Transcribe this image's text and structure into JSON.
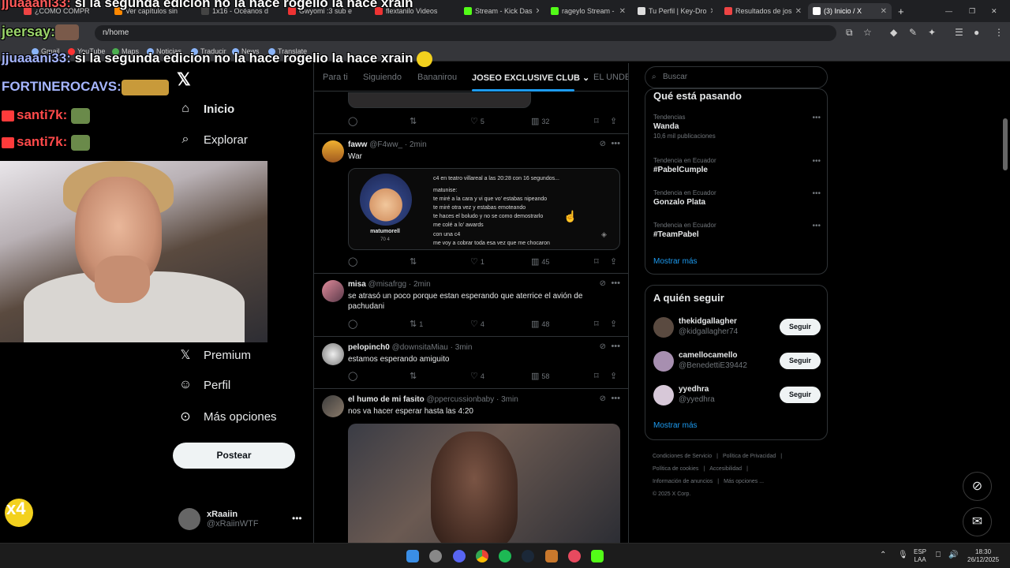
{
  "browser": {
    "tabs": [
      {
        "label": "¿CÓMO COMPR",
        "color": "#e44"
      },
      {
        "label": "Ver capítulos sin",
        "color": "#f80"
      },
      {
        "label": "1x16 - Océanos d",
        "color": "#444"
      },
      {
        "label": "Gwyomi :3 sub e",
        "color": "#e33"
      },
      {
        "label": "flextanilo Videos",
        "color": "#e33"
      },
      {
        "label": "Stream - Kick Das",
        "color": "#53fc18"
      },
      {
        "label": "rageylo Stream -",
        "color": "#53fc18"
      },
      {
        "label": "Tu Perfil | Key-Dro",
        "color": "#ddd"
      },
      {
        "label": "Resultados de jos",
        "color": "#e44"
      },
      {
        "label": "(3) Inicio / X",
        "color": "#fff"
      }
    ],
    "url": "n/home",
    "bookmarks": [
      "Gmail",
      "YouTube",
      "Maps",
      "Noticias",
      "Traducir",
      "News",
      "Translate"
    ]
  },
  "stream_overlay": {
    "chat": [
      {
        "user": "jjuaaani33:",
        "text": " si la segunda edicion no la hace rogelio la hace xrain"
      },
      {
        "user": "jeersay:",
        "text": ""
      },
      {
        "user": "jjuaaani33:",
        "text": " si la segunda edicion no la hace rogelio la hace xrain"
      },
      {
        "user": "FORTINEROCAVS:",
        "text": ""
      },
      {
        "user": "santi7k:",
        "text": ""
      },
      {
        "user": "santi7k:",
        "text": ""
      }
    ],
    "multiplier": "x4"
  },
  "sidebar": {
    "items": [
      {
        "label": "Inicio",
        "icon": "home-icon"
      },
      {
        "label": "Explorar",
        "icon": "search-icon"
      },
      {
        "label": "Premium",
        "icon": "x-icon"
      },
      {
        "label": "Perfil",
        "icon": "person-icon"
      },
      {
        "label": "Más opciones",
        "icon": "more-circle-icon"
      }
    ],
    "post_label": "Postear",
    "account": {
      "name": "xRaaiin",
      "handle": "@xRaiinWTF"
    }
  },
  "feed": {
    "tabs": [
      "Para ti",
      "Siguiendo",
      "Bananirou",
      "JOSEO EXCLUSIVE CLUB",
      "EL UNDER"
    ],
    "tweets": [
      {
        "name": "",
        "handle": "",
        "time": "",
        "text": "",
        "actions": {
          "reply": "",
          "retweet": "",
          "like": "5",
          "views": "32"
        }
      },
      {
        "name": "faww",
        "handle": "@F4ww_",
        "time": "· 2min",
        "text": "War",
        "card": {
          "user": "matumorell",
          "stats": "70  4",
          "lines": [
            "c4 en teatro villareal a las 20:28 con 16 segundos...",
            "matunise:",
            "te miré a la cara y vi que vo' estabas nipeando",
            "te miré otra vez y estabas emoteando",
            "te haces el boludo y no se como demostrarlo",
            "me colé a lo' awards",
            "con una c4",
            "me voy a cobrar toda esa vez que me chocaron"
          ]
        },
        "actions": {
          "reply": "",
          "retweet": "",
          "like": "1",
          "views": "45"
        }
      },
      {
        "name": "misa",
        "handle": "@misafrgg",
        "time": "· 2min",
        "text": "se atrasó un poco porque estan esperando que aterrice el avión de pachudani",
        "actions": {
          "reply": "",
          "retweet": "1",
          "like": "4",
          "views": "48"
        }
      },
      {
        "name": "pelopinch0",
        "handle": "@downsitaMiau",
        "time": "· 3min",
        "text": "estamos esperando amiguito",
        "actions": {
          "reply": "",
          "retweet": "",
          "like": "4",
          "views": "58"
        }
      },
      {
        "name": "el humo de mi fasito",
        "handle": "@ppercussionbaby",
        "time": "· 3min",
        "text": "nos va hacer esperar hasta las 4:20",
        "actions": {}
      }
    ]
  },
  "right": {
    "search_placeholder": "Buscar",
    "trends_title": "Qué está pasando",
    "trends": [
      {
        "context": "Tendencias",
        "name": "Wanda",
        "count": "10,6 mil publicaciones"
      },
      {
        "context": "Tendencia en Ecuador",
        "name": "#PabelCumple",
        "count": ""
      },
      {
        "context": "Tendencia en Ecuador",
        "name": "Gonzalo Plata",
        "count": ""
      },
      {
        "context": "Tendencia en Ecuador",
        "name": "#TeamPabel",
        "count": ""
      }
    ],
    "show_more": "Mostrar más",
    "follow_title": "A quién seguir",
    "follow": [
      {
        "name": "thekidgallagher",
        "handle": "@kidgallagher74",
        "btn": "Seguir",
        "color": "#5a4a40"
      },
      {
        "name": "camellocamello",
        "handle": "@BenedettiE39442",
        "btn": "Seguir",
        "color": "#a78fb0"
      },
      {
        "name": "yyedhra",
        "handle": "@yyedhra",
        "btn": "Seguir",
        "color": "#d7c8d8"
      }
    ],
    "show_more_2": "Mostrar más",
    "footer": [
      "Condiciones de Servicio",
      "|",
      "Política de Privacidad",
      "|",
      "Política de cookies",
      "|",
      "Accesibilidad",
      "|",
      "Información de anuncios",
      "|",
      "Más opciones ...",
      "© 2025 X Corp."
    ]
  },
  "taskbar": {
    "lang": "ESP",
    "lang2": "LAA",
    "time": "18:30",
    "date": "26/12/2025"
  }
}
